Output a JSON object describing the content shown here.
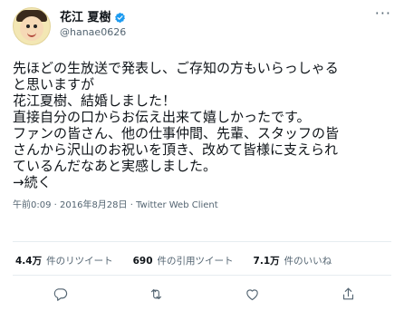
{
  "user": {
    "display_name": "花江 夏樹",
    "handle": "@hanae0626",
    "verified": true
  },
  "tweet": {
    "lines": [
      "先ほどの生放送で発表し、ご存知の方もいらっしゃる",
      "と思いますが",
      "花江夏樹、結婚しました！",
      "直接自分の口からお伝え出来て嬉しかったです。",
      "ファンの皆さん、他の仕事仲間、先輩、スタッフの皆",
      "さんから沢山のお祝いを頂き、改めて皆様に支えられ",
      "ているんだなあと実感しました。",
      "→続く"
    ],
    "meta": "午前0:09 · 2016年8月28日 · Twitter Web Client"
  },
  "stats": {
    "retweets_count": "4.4万",
    "retweets_label": "件のリツイート",
    "quotes_count": "690",
    "quotes_label": "件の引用ツイート",
    "likes_count": "7.1万",
    "likes_label": "件のいいね"
  },
  "icons": {
    "more": "more-icon",
    "verified": "verified-badge-icon",
    "reply": "reply-icon",
    "retweet": "retweet-icon",
    "like": "like-icon",
    "share": "share-icon"
  },
  "colors": {
    "verified": "#1d9bf0",
    "secondary_text": "#536471",
    "divider": "#e6ecf0"
  }
}
